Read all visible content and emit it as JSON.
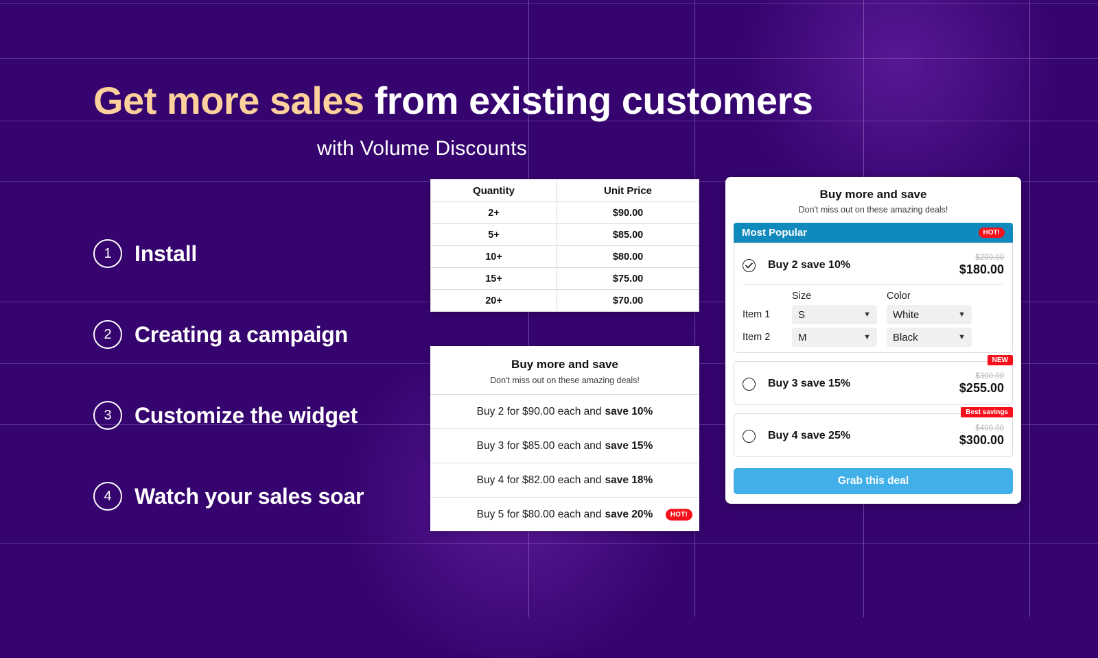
{
  "theme": {
    "background": "#35046e",
    "headline_accent": "#fdd19c",
    "badge_red": "#f5101b",
    "popular_blue": "#1089bd",
    "cta_blue": "#41afe8"
  },
  "hero": {
    "headline_accent": "Get more sales",
    "headline_rest": " from existing customers",
    "subheadline": "with Volume Discounts"
  },
  "steps": [
    {
      "number": "1",
      "label": "Install"
    },
    {
      "number": "2",
      "label": "Creating a campaign"
    },
    {
      "number": "3",
      "label": "Customize the widget"
    },
    {
      "number": "4",
      "label": "Watch your sales soar"
    }
  ],
  "price_table": {
    "headers": [
      "Quantity",
      "Unit Price"
    ],
    "rows": [
      [
        "2+",
        "$90.00"
      ],
      [
        "5+",
        "$85.00"
      ],
      [
        "10+",
        "$80.00"
      ],
      [
        "15+",
        "$75.00"
      ],
      [
        "20+",
        "$70.00"
      ]
    ]
  },
  "list_widget": {
    "title": "Buy more and save",
    "subtitle": "Don't miss out on these amazing deals!",
    "rows": [
      {
        "text": "Buy 2 for $90.00 each and",
        "save": "save 10%",
        "badge": ""
      },
      {
        "text": "Buy 3 for $85.00 each and",
        "save": "save 15%",
        "badge": ""
      },
      {
        "text": "Buy 4 for $82.00 each and",
        "save": "save 18%",
        "badge": ""
      },
      {
        "text": "Buy 5 for $80.00 each and",
        "save": "save 20%",
        "badge": "HOT!"
      }
    ]
  },
  "advanced_widget": {
    "title": "Buy more and save",
    "subtitle": "Don't miss out on these amazing deals!",
    "popular_label": "Most Popular",
    "popular_badge": "HOT!",
    "offers": [
      {
        "name": "Buy 2 save 10%",
        "price_old": "$200.00",
        "price_new": "$180.00",
        "selected": true,
        "badge": ""
      },
      {
        "name": "Buy 3 save 15%",
        "price_old": "$300.00",
        "price_new": "$255.00",
        "selected": false,
        "badge": "NEW"
      },
      {
        "name": "Buy 4 save 25%",
        "price_old": "$400.00",
        "price_new": "$300.00",
        "selected": false,
        "badge": "Best savings"
      }
    ],
    "variants": {
      "col_headers": [
        "Size",
        "Color"
      ],
      "items": [
        {
          "label": "Item 1",
          "size": "S",
          "color": "White"
        },
        {
          "label": "Item 2",
          "size": "M",
          "color": "Black"
        }
      ]
    },
    "cta_label": "Grab this deal"
  }
}
